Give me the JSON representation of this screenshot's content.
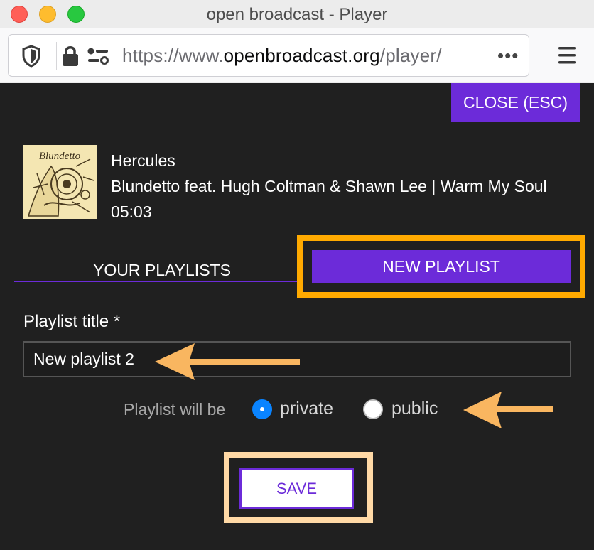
{
  "window": {
    "title": "open broadcast - Player"
  },
  "browser": {
    "url_prefix": "https://www.",
    "url_domain": "openbroadcast.org",
    "url_path": "/player/",
    "more_glyph": "•••"
  },
  "player": {
    "close_label": "CLOSE (ESC)",
    "track": {
      "title": "Hercules",
      "artist_release": "Blundetto feat. Hugh Coltman & Shawn Lee | Warm My Soul",
      "duration": "05:03",
      "cover_text": "Blundetto"
    },
    "tabs": [
      {
        "label": "YOUR PLAYLISTS",
        "active": false
      },
      {
        "label": "NEW PLAYLIST",
        "active": true
      }
    ],
    "form": {
      "title_label": "Playlist title *",
      "title_value": "New playlist 2",
      "visibility_label": "Playlist will be",
      "visibility_options": [
        {
          "label": "private",
          "selected": true
        },
        {
          "label": "public",
          "selected": false
        }
      ],
      "save_label": "SAVE"
    }
  },
  "colors": {
    "accent": "#6c2bd9",
    "highlight": "#ffaa00",
    "highlight_light": "#ffd9a6",
    "arrow": "#f9b660",
    "page_bg": "#202020"
  }
}
